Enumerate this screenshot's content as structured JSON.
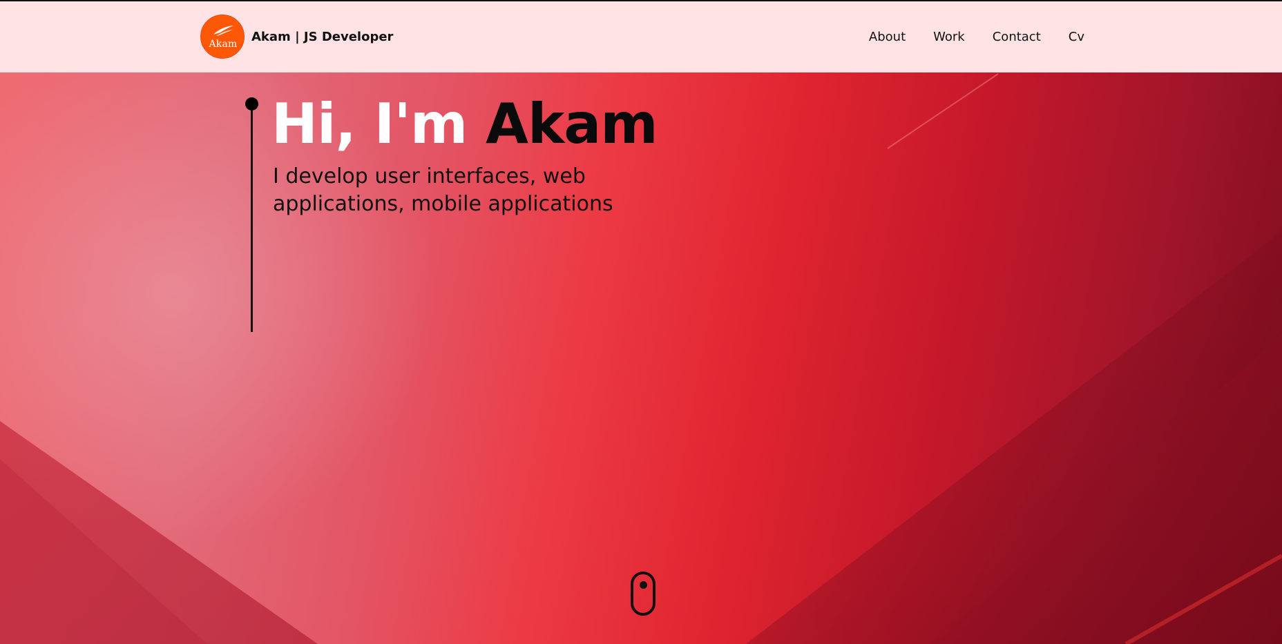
{
  "header": {
    "logo_text": "Akam",
    "brand_label": "Akam  | JS Developer",
    "nav": [
      {
        "label": "About"
      },
      {
        "label": "Work"
      },
      {
        "label": "Contact"
      },
      {
        "label": "Cv"
      }
    ]
  },
  "hero": {
    "greeting_part1": "Hi, I'm",
    "greeting_part2": "Akam",
    "subtitle": "I develop user interfaces, web applications, mobile applications"
  },
  "colors": {
    "navbar_bg": "#ffe2e3",
    "logo_bg": "#fc5808",
    "hero_primary": "#e02530",
    "hero_dark": "#7a0d1c"
  },
  "icons": {
    "logo": "wing-icon",
    "scroll_indicator": "mouse-scroll-icon"
  }
}
